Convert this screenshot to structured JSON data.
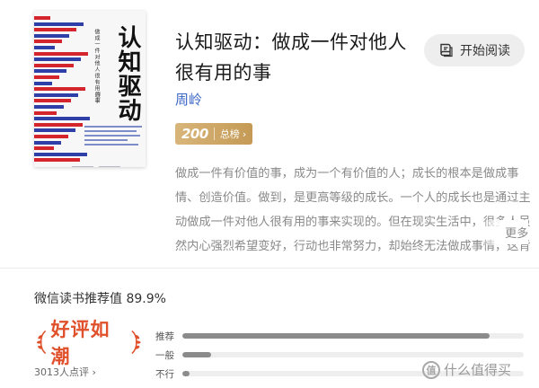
{
  "book": {
    "title": "认知驱动：做成一件对他人很有用的事",
    "author": "周岭",
    "cover": {
      "title": "认知驱动",
      "subtitle": "做成一件对他人很有用的事",
      "author": "周岭"
    }
  },
  "actions": {
    "read_label": "开始阅读"
  },
  "badge": {
    "rank": "200",
    "label": "总榜",
    "chevron": "›"
  },
  "description": {
    "text": "做成一件有价值的事，成为一个有价值的人；成长的根本是做成事情、创造价值。做到，是更高等级的成长。一个人的成长也是通过主动做成一件对他人很有用的事来实现的。但在现实生活中，很多人虽然内心强烈希望变好，行动也非常努力，却始终无法做成事情，这背后的",
    "more_label": "更多"
  },
  "rating": {
    "title": "微信读书推荐值 89.9%",
    "award_text": "好评如潮",
    "review_count": "3013人点评",
    "review_chevron": "›",
    "bars": [
      {
        "label": "推荐",
        "value": 0.9
      },
      {
        "label": "一般",
        "value": 0.085
      },
      {
        "label": "不行",
        "value": 0.02
      }
    ]
  },
  "watermark": {
    "text": "什么值得买",
    "logo": "值"
  },
  "colors": {
    "author": "#3a66c7",
    "badge": "#c9a063",
    "award": "#e0502a",
    "bar_fill": "#8b8b8b",
    "bar_track": "#eeeeee"
  },
  "icons": {
    "read_button": "book-reading-icon",
    "award_left": "laurel-left-icon",
    "award_right": "laurel-right-icon"
  }
}
